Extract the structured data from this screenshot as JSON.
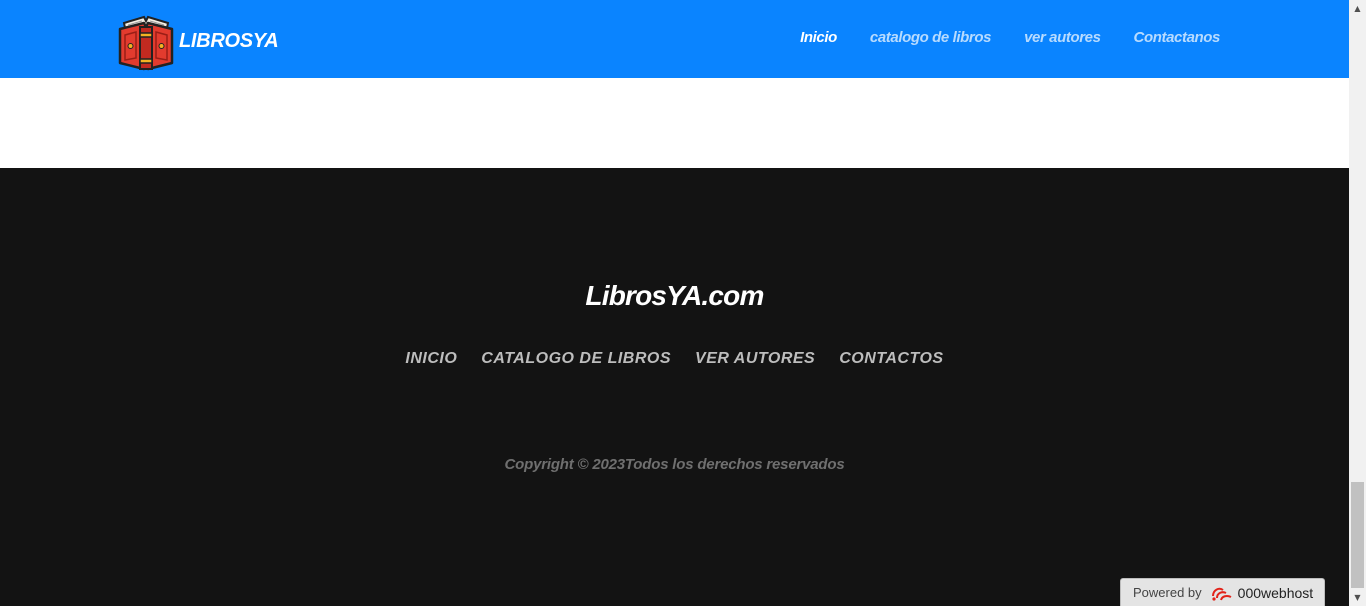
{
  "header": {
    "brand": "LIBROSYA",
    "logo_icon": "open-book-icon",
    "nav": [
      {
        "label": "Inicio",
        "active": true
      },
      {
        "label": "catalogo de libros",
        "active": false
      },
      {
        "label": "ver autores",
        "active": false
      },
      {
        "label": "Contactanos",
        "active": false
      }
    ],
    "colors": {
      "background": "#0a84ff",
      "link": "#b7dbff",
      "active_link": "#ffffff"
    }
  },
  "footer": {
    "title": "LibrosYA.com",
    "links": [
      "INICIO",
      "CATALOGO DE LIBROS",
      "VER AUTORES",
      "CONTACTOS"
    ],
    "copyright": "Copyright © 2023Todos los derechos reservados",
    "colors": {
      "background": "#131313"
    }
  },
  "badge": {
    "label": "Powered by",
    "brand": "000webhost",
    "icon": "000webhost-logo-icon"
  }
}
